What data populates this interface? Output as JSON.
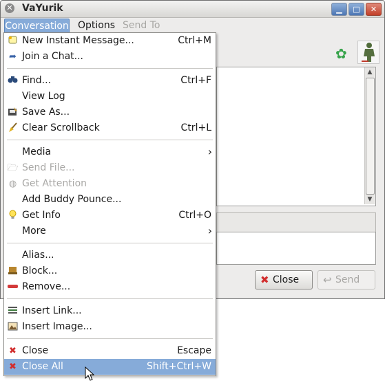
{
  "window": {
    "title": "VaYurik",
    "controls": [
      "minimize",
      "maximize",
      "close"
    ]
  },
  "menubar": {
    "items": [
      {
        "label": "Conversation",
        "state": "open"
      },
      {
        "label": "Options",
        "state": "normal"
      },
      {
        "label": "Send To",
        "state": "disabled"
      }
    ]
  },
  "menu": {
    "items": [
      {
        "label": "New Instant Message...",
        "accel": "Ctrl+M",
        "icon": "new-message-icon"
      },
      {
        "label": "Join a Chat...",
        "accel": "",
        "icon": "join-chat-icon"
      },
      {
        "label": "Find...",
        "accel": "Ctrl+F",
        "icon": "binoculars-icon"
      },
      {
        "label": "View Log",
        "accel": "",
        "icon": ""
      },
      {
        "label": "Save As...",
        "accel": "",
        "icon": "save-as-icon"
      },
      {
        "label": "Clear Scrollback",
        "accel": "Ctrl+L",
        "icon": "broom-icon"
      },
      {
        "label": "Media",
        "accel": "",
        "icon": "",
        "submenu": true
      },
      {
        "label": "Send File...",
        "accel": "",
        "icon": "send-file-icon",
        "disabled": true
      },
      {
        "label": "Get Attention",
        "accel": "",
        "icon": "attention-icon",
        "disabled": true
      },
      {
        "label": "Add Buddy Pounce...",
        "accel": "",
        "icon": ""
      },
      {
        "label": "Get Info",
        "accel": "Ctrl+O",
        "icon": "lightbulb-icon"
      },
      {
        "label": "More",
        "accel": "",
        "icon": "",
        "submenu": true
      },
      {
        "label": "Alias...",
        "accel": "",
        "icon": ""
      },
      {
        "label": "Block...",
        "accel": "",
        "icon": "block-icon"
      },
      {
        "label": "Remove...",
        "accel": "",
        "icon": "remove-icon"
      },
      {
        "label": "Insert Link...",
        "accel": "",
        "icon": "insert-link-icon"
      },
      {
        "label": "Insert Image...",
        "accel": "",
        "icon": "insert-image-icon"
      },
      {
        "label": "Close",
        "accel": "Escape",
        "icon": "close-x-icon"
      },
      {
        "label": "Close All",
        "accel": "Shift+Ctrl+W",
        "icon": "close-all-icon",
        "highlighted": true
      }
    ]
  },
  "buttons": {
    "close_label": "Close",
    "send_label": "Send"
  },
  "colors": {
    "highlight": "#86abd9",
    "disabled_text": "#a9a8a6",
    "close_red": "#d22d2d"
  }
}
